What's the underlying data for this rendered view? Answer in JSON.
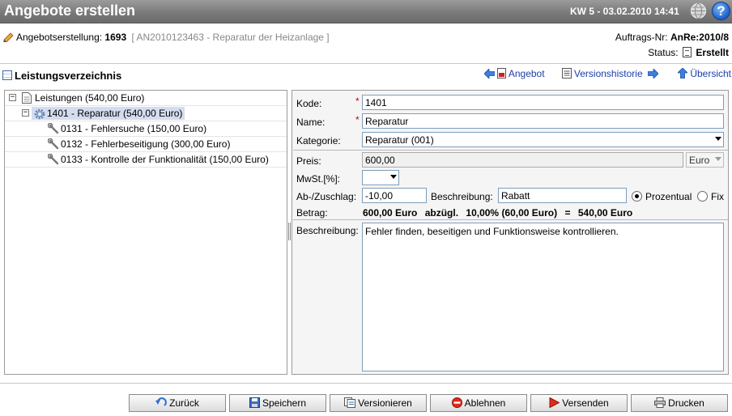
{
  "window": {
    "title": "Angebote erstellen",
    "datetime": "KW 5 - 03.02.2010 14:41",
    "globe_icon": "globe-icon",
    "help_icon": "help-icon",
    "help_symbol": "?"
  },
  "header": {
    "offer_label": "Angebotserstellung:",
    "offer_number": "1693",
    "offer_reference": "[ AN2010123463 - Reparatur der Heizanlage ]",
    "order_label": "Auftrags-Nr:",
    "order_number": "AnRe:2010/8",
    "status_label": "Status:",
    "status_value": "Erstellt"
  },
  "section": {
    "title": "Leistungsverzeichnis",
    "links": {
      "offer": "Angebot",
      "history": "Versionshistorie",
      "overview": "Übersicht"
    }
  },
  "tree": [
    {
      "label": "Leistungen (540,00 Euro)",
      "level": 0,
      "icon": "document-icon",
      "toggle": "−",
      "selected": false
    },
    {
      "label": "1401 - Reparatur (540,00 Euro)",
      "level": 1,
      "icon": "gear-icon",
      "toggle": "−",
      "selected": true
    },
    {
      "label": "0131 - Fehlersuche (150,00 Euro)",
      "level": 2,
      "icon": "wrench-icon",
      "toggle": "",
      "selected": false
    },
    {
      "label": "0132 - Fehlerbeseitigung (300,00 Euro)",
      "level": 2,
      "icon": "wrench-icon",
      "toggle": "",
      "selected": false
    },
    {
      "label": "0133 - Kontrolle der Funktionalität (150,00 Euro)",
      "level": 2,
      "icon": "wrench-icon",
      "toggle": "",
      "selected": false
    }
  ],
  "form": {
    "code_label": "Kode:",
    "code_value": "1401",
    "name_label": "Name:",
    "name_value": "Reparatur",
    "required_mark": "*",
    "category_label": "Kategorie:",
    "category_value": "Reparatur (001)",
    "price_label": "Preis:",
    "price_value": "600,00",
    "currency_value": "Euro",
    "vat_label": "MwSt.[%]:",
    "vat_value": "",
    "surcharge_label": "Ab-/Zuschlag:",
    "surcharge_value": "-10,00",
    "surcharge_desc_label": "Beschreibung:",
    "surcharge_desc_value": "Rabatt",
    "radio_percent": "Prozentual",
    "radio_fixed": "Fix",
    "amount_label": "Betrag:",
    "amount_base": "600,00 Euro",
    "amount_less": "abzügl.",
    "amount_discount": "10,00% (60,00 Euro)",
    "amount_equals": "=",
    "amount_total": "540,00 Euro",
    "description_label": "Beschreibung:",
    "description_value": "Fehler finden, beseitigen und Funktionsweise kontrollieren."
  },
  "buttons": {
    "back": "Zurück",
    "save": "Speichern",
    "version": "Versionieren",
    "reject": "Ablehnen",
    "send": "Versenden",
    "print": "Drucken"
  }
}
